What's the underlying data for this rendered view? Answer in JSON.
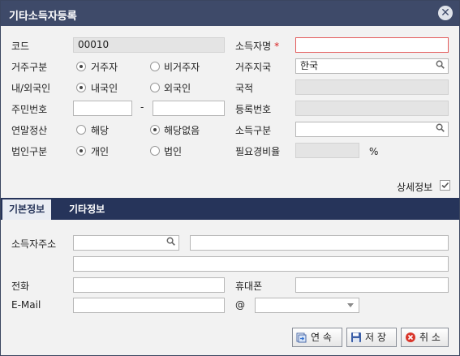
{
  "dialog": {
    "title": "기타소득자등록"
  },
  "form": {
    "code": {
      "label": "코드",
      "value": "00010"
    },
    "name": {
      "label": "소득자명",
      "required_mark": "*",
      "value": ""
    },
    "residency": {
      "label": "거주구분",
      "options": [
        "거주자",
        "비거주자"
      ],
      "selected": "거주자"
    },
    "region": {
      "label": "거주지국",
      "value": "한국"
    },
    "nationality_type": {
      "label": "내/외국인",
      "options": [
        "내국인",
        "외국인"
      ],
      "selected": "내국인"
    },
    "nationality": {
      "label": "국적",
      "value": ""
    },
    "resident_no": {
      "label": "주민번호",
      "separator": "-",
      "part1": "",
      "part2": ""
    },
    "reg_no": {
      "label": "등록번호",
      "value": ""
    },
    "year_end": {
      "label": "연말정산",
      "options": [
        "해당",
        "해당없음"
      ],
      "selected": "해당없음"
    },
    "income_type": {
      "label": "소득구분",
      "value": ""
    },
    "corp_type": {
      "label": "법인구분",
      "options": [
        "개인",
        "법인"
      ],
      "selected": "개인"
    },
    "expense_rate": {
      "label": "필요경비율",
      "value": "",
      "unit": "%"
    },
    "detail": {
      "label": "상세정보",
      "checked": true
    }
  },
  "tabs": [
    {
      "label": "기본정보",
      "active": true
    },
    {
      "label": "기타정보",
      "active": false
    }
  ],
  "basic_info": {
    "address": {
      "label": "소득자주소",
      "zip": "",
      "line1": "",
      "line2": ""
    },
    "phone": {
      "label": "전화",
      "value": ""
    },
    "mobile": {
      "label": "휴대폰",
      "value": ""
    },
    "email": {
      "label": "E-Mail",
      "at": "@",
      "id": "",
      "domain": ""
    }
  },
  "buttons": {
    "continue": "연 속",
    "save": "저 장",
    "cancel": "취 소"
  },
  "icons": {
    "close": "close-icon",
    "search": "search-icon",
    "continue": "continue-icon",
    "save": "floppy-icon",
    "cancel": "cancel-icon"
  },
  "colors": {
    "titlebar": "#3e4a69",
    "tabbar": "#26345a",
    "required": "#d81e1e"
  }
}
